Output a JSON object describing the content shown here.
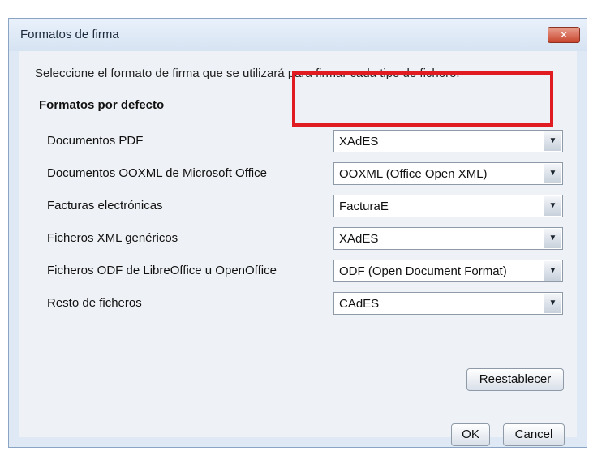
{
  "window": {
    "title": "Formatos de firma",
    "close_label": "✕"
  },
  "instruction": "Seleccione el formato de firma que se utilizará para firmar cada tipo de fichero.",
  "section_title": "Formatos por defecto",
  "rows": [
    {
      "label": "Documentos PDF",
      "value": "XAdES",
      "highlighted": true
    },
    {
      "label": "Documentos OOXML de Microsoft Office",
      "value": "OOXML (Office Open XML)"
    },
    {
      "label": "Facturas electrónicas",
      "value": "FacturaE"
    },
    {
      "label": "Ficheros XML genéricos",
      "value": "XAdES"
    },
    {
      "label": "Ficheros ODF de LibreOffice u OpenOffice",
      "value": "ODF (Open Document Format)"
    },
    {
      "label": "Resto de ficheros",
      "value": "CAdES"
    }
  ],
  "buttons": {
    "reset": "Reestablecer",
    "ok": "OK",
    "cancel": "Cancel"
  },
  "colors": {
    "highlight": "#e01c22",
    "window_bg": "#dfe9f5",
    "close_button": "#c8452e"
  },
  "icons": {
    "dropdown": "chevron-down-icon",
    "close": "close-icon"
  }
}
